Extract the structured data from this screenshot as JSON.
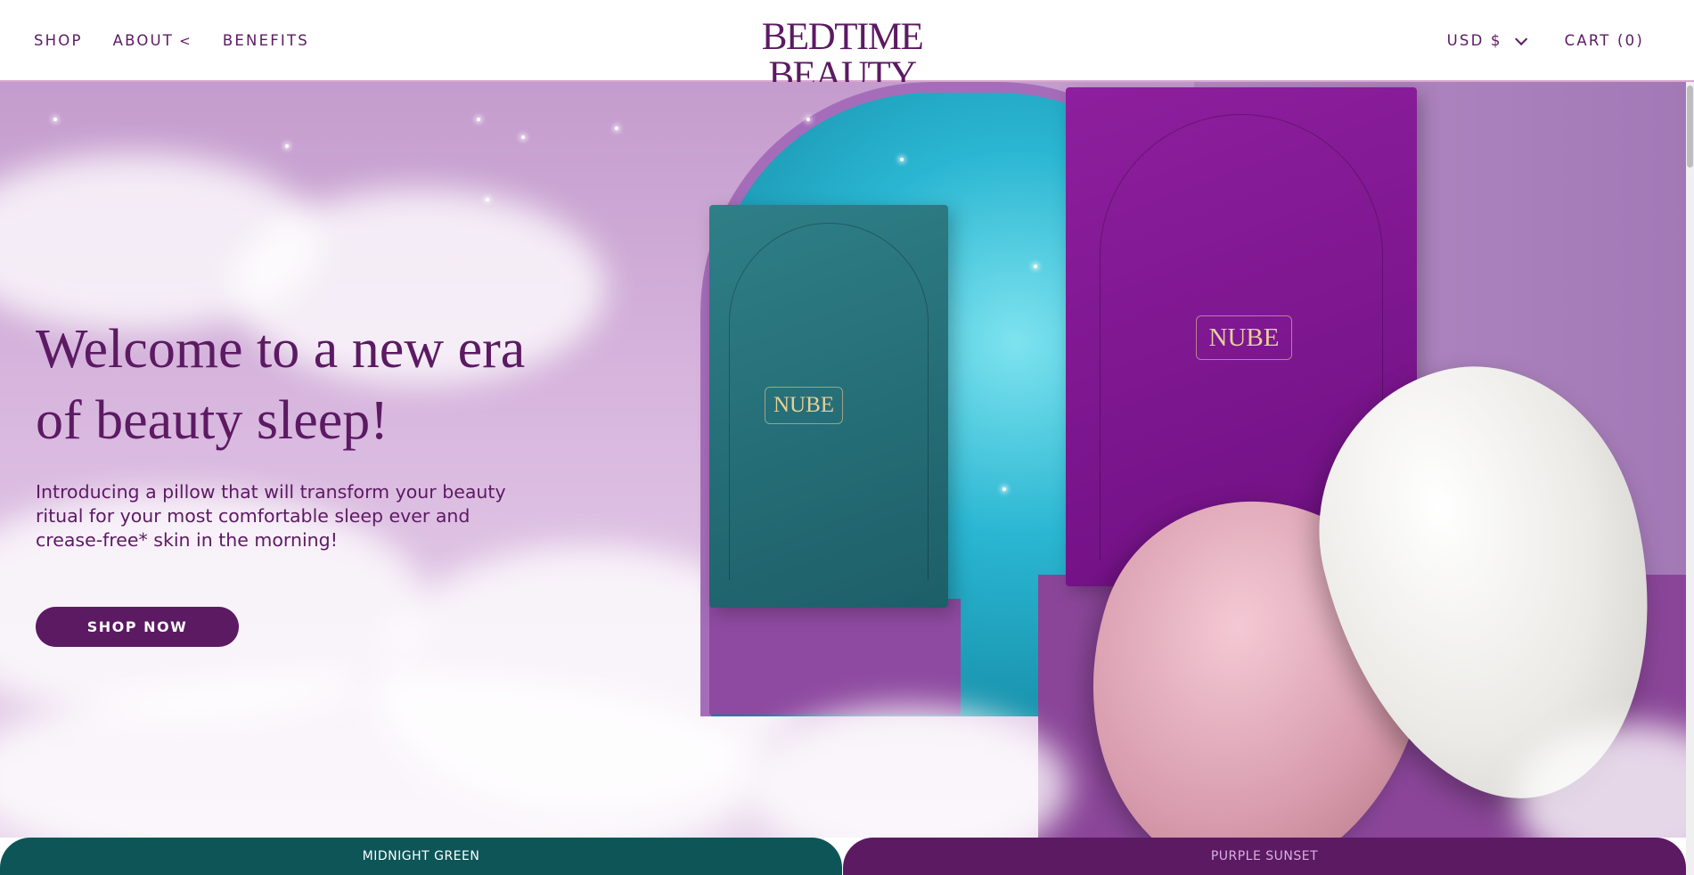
{
  "nav": {
    "left": [
      {
        "label": "SHOP"
      },
      {
        "label": "ABOUT",
        "chevron": "<"
      },
      {
        "label": "BENEFITS"
      }
    ],
    "logo": "BEDTIME BEAUTY",
    "currency": "USD $",
    "cart": "CART (0)"
  },
  "hero": {
    "title_line1": "Welcome to a new era",
    "title_line2": "of beauty sleep!",
    "text": "Introducing a pillow that will transform your beauty ritual for your most comfortable sleep ever and crease-free* skin in the morning!",
    "cta": "SHOP NOW",
    "box_label_green": "NUBE",
    "box_label_purple": "NUBE"
  },
  "variants": [
    {
      "label": "MIDNIGHT GREEN",
      "color": "#0e5558"
    },
    {
      "label": "PURPLE SUNSET",
      "color": "#5c1a63"
    }
  ],
  "colors": {
    "brand": "#5c1a63",
    "accent_border": "#d8a6cf"
  },
  "icons": {
    "currency_dropdown": "chevron-down-icon",
    "about_toggle": "chevron-left-icon"
  }
}
